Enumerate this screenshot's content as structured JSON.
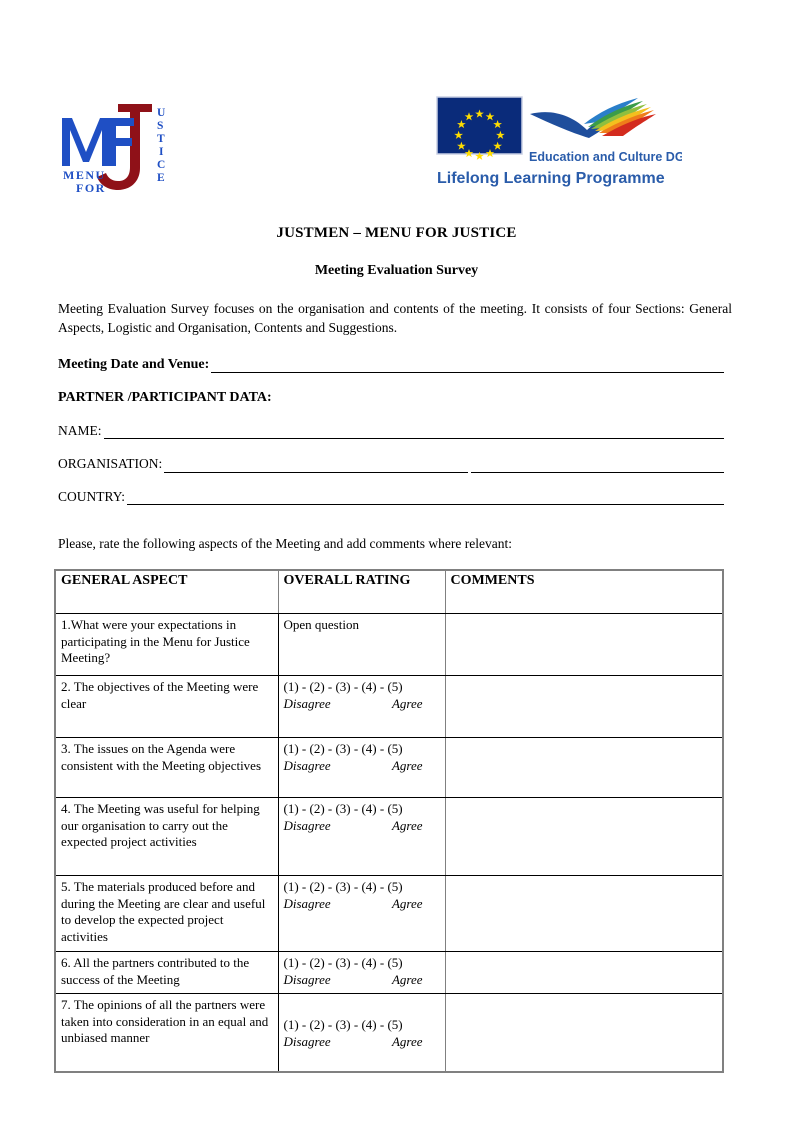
{
  "logos": {
    "mfj": {
      "name": "menu-for-justice-logo",
      "letters_blue": "MF",
      "menu": "MENU",
      "for": "FOR",
      "j": "J",
      "justice_vertical": [
        "U",
        "S",
        "T",
        "I",
        "C",
        "E"
      ],
      "blue": "#1f4fc4",
      "red": "#8f1118"
    },
    "eu": {
      "name": "lifelong-learning-programme-logo",
      "flag_alt": "european-union-flag",
      "dg_text": "Education and Culture DG",
      "programme_text": "Lifelong Learning Programme",
      "flag_blue": "#0a2b7a",
      "star_yellow": "#ffdd00",
      "text_blue": "#2a5caa",
      "swoosh_blue": "#1f4e9c",
      "stripe_colors": [
        "#d32b1e",
        "#ef7d1a",
        "#f4c01e",
        "#8fbf3f",
        "#3b9c49",
        "#2a7fc9"
      ]
    }
  },
  "document": {
    "title": "JUSTMEN – MENU FOR JUSTICE",
    "subtitle": "Meeting Evaluation Survey",
    "intro": "Meeting Evaluation Survey focuses on the organisation and contents of the meeting. It consists of four Sections: General Aspects, Logistic and Organisation, Contents and Suggestions."
  },
  "form": {
    "meeting_date_venue_label": "Meeting Date and Venue:",
    "partner_participant_heading": "PARTNER /PARTICIPANT DATA:",
    "name_label": "NAME:",
    "organisation_label": "ORGANISATION:",
    "country_label": "COUNTRY:",
    "meeting_date_venue_value": "",
    "name_value": "",
    "organisation_value": "",
    "country_value": ""
  },
  "rate_instruction": "Please, rate the following aspects of the Meeting and add comments where relevant:",
  "table": {
    "headers": {
      "aspect": "GENERAL ASPECT",
      "rating": "OVERALL RATING",
      "comments": "COMMENTS"
    },
    "scale": "(1) - (2) - (3) - (4) - (5)",
    "low_label": "Disagree",
    "high_label": "Agree",
    "open_question": "Open question",
    "rows": [
      {
        "aspect": "1.What were your expectations in participating in the Menu for Justice Meeting?",
        "rating_type": "open",
        "comment": ""
      },
      {
        "aspect": "2. The objectives of the Meeting were clear",
        "rating_type": "scale",
        "comment": ""
      },
      {
        "aspect": "3. The issues on the Agenda were consistent with the Meeting objectives",
        "rating_type": "scale",
        "comment": ""
      },
      {
        "aspect": "4. The Meeting was useful for helping our organisation to carry out the expected project activities",
        "rating_type": "scale",
        "comment": ""
      },
      {
        "aspect": "5. The materials  produced before and during the Meeting are clear and useful to develop the expected project activities",
        "rating_type": "scale",
        "comment": ""
      },
      {
        "aspect": "6. All the partners contributed to the success of the Meeting",
        "rating_type": "scale",
        "comment": ""
      },
      {
        "aspect": "7. The opinions of all the partners were taken into consideration in an equal and unbiased manner",
        "rating_type": "scale",
        "comment": ""
      }
    ]
  }
}
